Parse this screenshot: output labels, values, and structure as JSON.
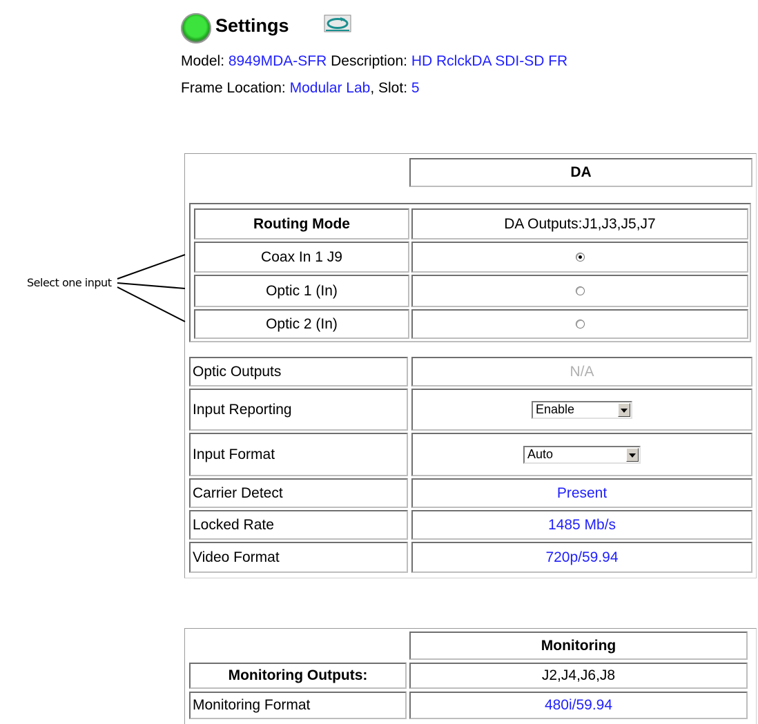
{
  "header": {
    "title": "Settings",
    "status_icon": "green-status-led-icon",
    "refresh_icon": "refresh-icon",
    "model_label": "Model:",
    "model_value": "8949MDA-SFR",
    "description_label": "Description:",
    "description_value": "HD RclckDA SDI-SD FR",
    "frame_location_label": "Frame Location:",
    "frame_location_value": "Modular Lab",
    "slot_label": ", Slot:",
    "slot_value": "5"
  },
  "da_panel": {
    "column_header": "DA",
    "routing": {
      "mode_label": "Routing Mode",
      "outputs_label": "DA Outputs:J1,J3,J5,J7",
      "inputs": [
        {
          "label": "Coax In 1 J9",
          "selected": true
        },
        {
          "label": "Optic 1 (In)",
          "selected": false
        },
        {
          "label": "Optic 2 (In)",
          "selected": false
        }
      ]
    },
    "rows": {
      "optic_outputs": {
        "label": "Optic Outputs",
        "value": "N/A"
      },
      "input_reporting": {
        "label": "Input Reporting",
        "value": "Enable"
      },
      "input_format": {
        "label": "Input Format",
        "value": "Auto"
      },
      "carrier_detect": {
        "label": "Carrier Detect",
        "value": "Present"
      },
      "locked_rate": {
        "label": "Locked Rate",
        "value": "1485 Mb/s"
      },
      "video_format": {
        "label": "Video Format",
        "value": "720p/59.94"
      }
    }
  },
  "monitoring_panel": {
    "column_header": "Monitoring",
    "outputs_label": "Monitoring Outputs:",
    "outputs_value": "J2,J4,J6,J8",
    "format_label": "Monitoring Format",
    "format_value": "480i/59.94"
  },
  "callout": {
    "text": "Select one input"
  },
  "colors": {
    "value_blue": "#1f1fff",
    "disabled_grey": "#b0b0b0",
    "led_green": "#3ce33c"
  }
}
